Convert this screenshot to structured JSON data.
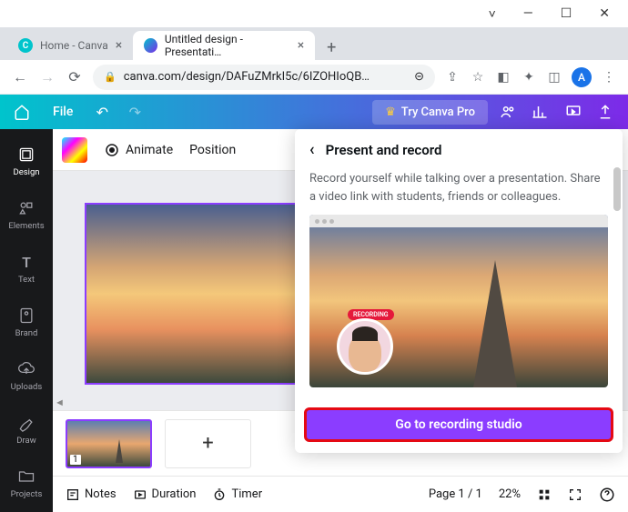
{
  "window": {
    "minimize": "—",
    "maximize": "☐",
    "close": "✕",
    "down": "˅"
  },
  "tabs": {
    "inactive": {
      "title": "Home - Canva",
      "favicon_letter": "C"
    },
    "active": {
      "title": "Untitled design - Presentati…"
    }
  },
  "url": "canva.com/design/DAFuZMrkI5c/6IZOHIoQB…",
  "avatar_letter": "A",
  "canva": {
    "file": "File",
    "try_pro": "Try Canva Pro"
  },
  "sidebar": {
    "items": [
      {
        "label": "Design"
      },
      {
        "label": "Elements"
      },
      {
        "label": "Text"
      },
      {
        "label": "Brand"
      },
      {
        "label": "Uploads"
      },
      {
        "label": "Draw"
      },
      {
        "label": "Projects"
      }
    ]
  },
  "subbar": {
    "animate": "Animate",
    "position": "Position"
  },
  "panel": {
    "title": "Present and record",
    "desc": "Record yourself while talking over a presentation. Share a video link with students, friends or colleagues.",
    "recording_badge": "RECORDING",
    "cta": "Go to recording studio"
  },
  "thumb": {
    "num": "1"
  },
  "bottom": {
    "notes": "Notes",
    "duration": "Duration",
    "timer": "Timer",
    "page": "Page 1 / 1",
    "zoom": "22%"
  }
}
